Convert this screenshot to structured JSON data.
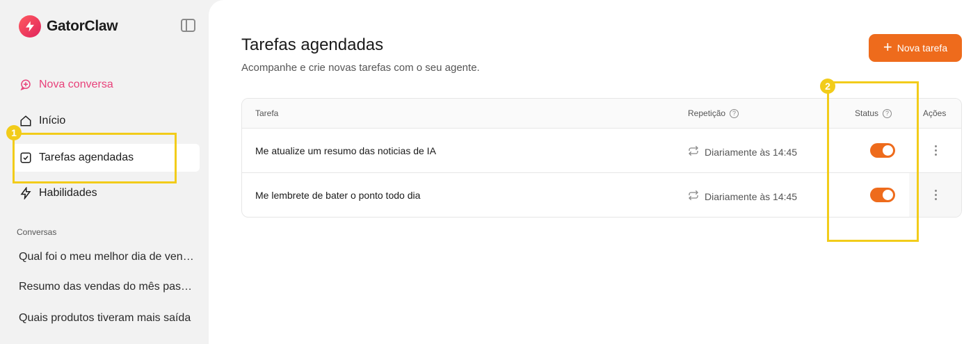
{
  "brand": {
    "name": "GatorClaw",
    "logo_icon": "lightning-bolt-icon",
    "accent": "#e8417a"
  },
  "sidebar": {
    "new_chat_label": "Nova conversa",
    "items": [
      {
        "label": "Início",
        "icon": "home-icon"
      },
      {
        "label": "Tarefas agendadas",
        "icon": "checkbox-icon",
        "active": true
      },
      {
        "label": "Habilidades",
        "icon": "lightning-icon"
      }
    ],
    "conversations_label": "Conversas",
    "conversations": [
      "Qual foi o meu melhor dia de vendas",
      "Resumo das vendas do mês passado",
      "Quais produtos tiveram mais saída"
    ]
  },
  "main": {
    "title": "Tarefas agendadas",
    "subtitle": "Acompanhe e crie novas tarefas com o seu agente.",
    "new_task_label": "Nova tarefa",
    "button_color": "#ee6b1c",
    "table": {
      "headers": {
        "task": "Tarefa",
        "repetition": "Repetição",
        "status": "Status",
        "actions": "Ações"
      },
      "rows": [
        {
          "task": "Me atualize um resumo das noticias de IA",
          "repetition": "Diariamente às 14:45",
          "status_on": true
        },
        {
          "task": "Me lembrete de bater o ponto todo dia",
          "repetition": "Diariamente às 14:45",
          "status_on": true
        }
      ]
    }
  },
  "annotations": {
    "badge_1": "1",
    "badge_2": "2",
    "color": "#f2cc1a"
  }
}
